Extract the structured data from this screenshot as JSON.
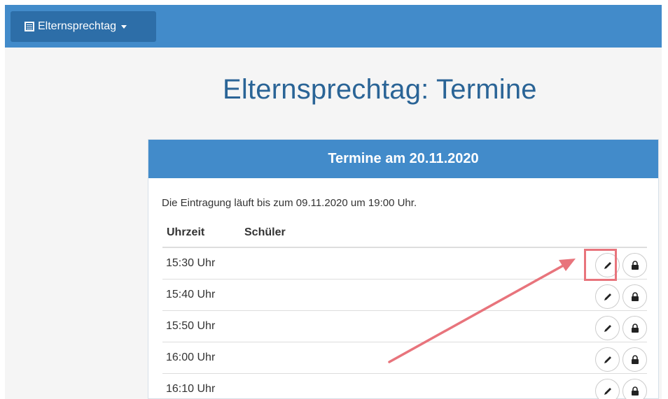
{
  "navbar": {
    "menu_label": "Elternsprechtag",
    "menu_icon": "list-icon",
    "caret_icon": "caret-down-icon"
  },
  "page": {
    "title": "Elternsprechtag: Termine"
  },
  "panel": {
    "heading": "Termine am 20.11.2020",
    "info": "Die Eintragung läuft bis zum 09.11.2020 um 19:00 Uhr.",
    "columns": [
      "Uhrzeit",
      "Schüler"
    ],
    "rows": [
      {
        "time": "15:30 Uhr",
        "student": ""
      },
      {
        "time": "15:40 Uhr",
        "student": ""
      },
      {
        "time": "15:50 Uhr",
        "student": ""
      },
      {
        "time": "16:00 Uhr",
        "student": ""
      },
      {
        "time": "16:10 Uhr",
        "student": ""
      }
    ],
    "row_actions": [
      "pencil-icon",
      "lock-icon"
    ]
  },
  "colors": {
    "navbar": "#428bca",
    "menu_button": "#2d6ea8",
    "title": "#2a6496",
    "annotation": "#e8747c"
  }
}
